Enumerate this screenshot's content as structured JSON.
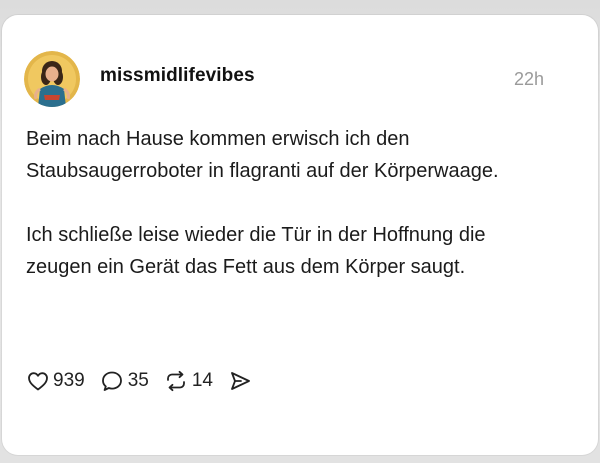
{
  "post": {
    "username": "missmidlifevibes",
    "time": "22h",
    "paragraphs": [
      "Beim nach Hause kommen erwisch ich den Staubsaugerroboter in flagranti auf der Körperwaage.",
      "Ich schließe leise wieder die Tür in der Hoffnung die zeugen ein Gerät das Fett aus dem Körper saugt."
    ]
  },
  "actions": {
    "likes": "939",
    "replies": "35",
    "reposts": "14"
  },
  "icons": {
    "like": "heart-icon",
    "reply": "comment-icon",
    "repost": "repost-icon",
    "share": "send-icon"
  },
  "colors": {
    "avatar_bg": "#e3b64a",
    "muted_text": "#9a9a9a"
  }
}
